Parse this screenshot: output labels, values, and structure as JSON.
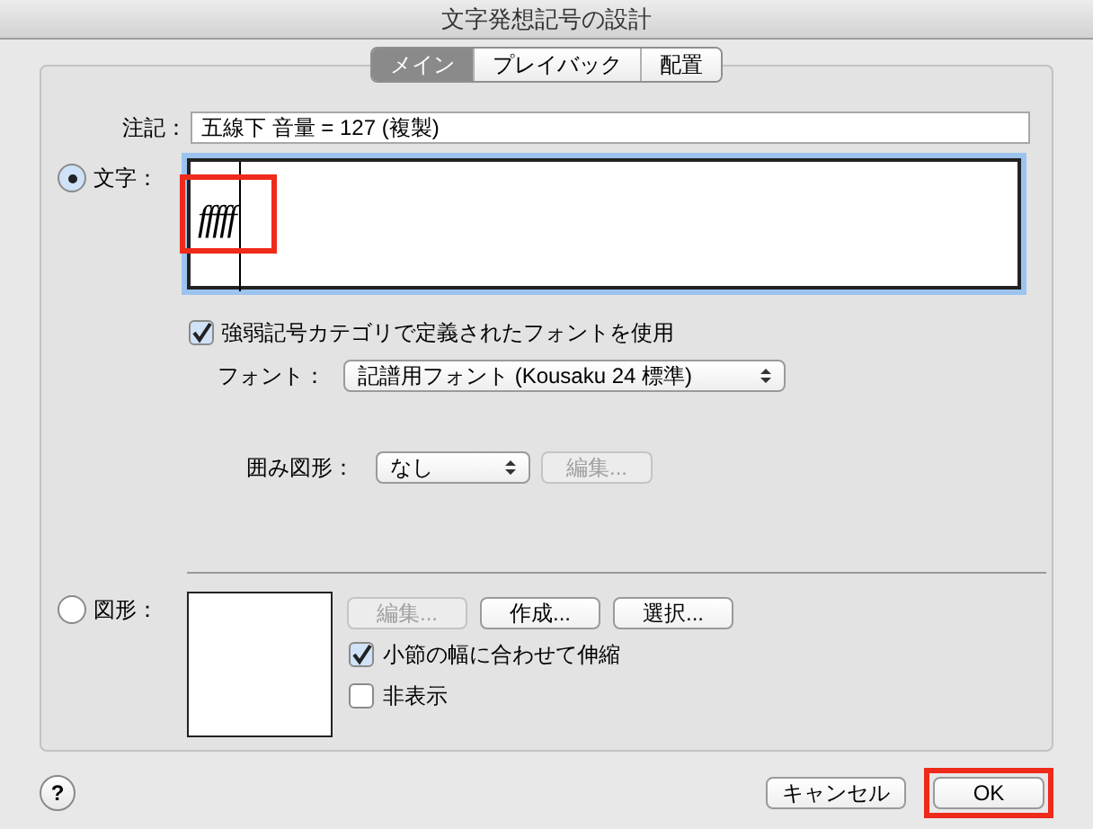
{
  "window": {
    "title": "文字発想記号の設計"
  },
  "tabs": [
    {
      "label": "メイン",
      "selected": true
    },
    {
      "label": "プレイバック",
      "selected": false
    },
    {
      "label": "配置",
      "selected": false
    }
  ],
  "annotation": {
    "label": "注記：",
    "value": "五線下 音量 = 127 (複製)"
  },
  "text_option": {
    "label": "文字：",
    "selected": true,
    "value": "fffff",
    "highlighted": true
  },
  "use_category_font": {
    "label": "強弱記号カテゴリで定義されたフォントを使用",
    "checked": true
  },
  "font": {
    "label": "フォント：",
    "value": "記譜用フォント (Kousaku 24 標準)"
  },
  "enclosure": {
    "label": "囲み図形：",
    "value": "なし",
    "edit_button": {
      "label": "編集...",
      "disabled": true
    }
  },
  "shape_option": {
    "label": "図形：",
    "selected": false
  },
  "shape_buttons": [
    {
      "label": "編集...",
      "disabled": true
    },
    {
      "label": "作成...",
      "disabled": false
    },
    {
      "label": "選択...",
      "disabled": false
    }
  ],
  "shape_checkboxes": [
    {
      "label": "小節の幅に合わせて伸縮",
      "checked": true
    },
    {
      "label": "非表示",
      "checked": false
    }
  ],
  "help": {
    "label": "?"
  },
  "buttons": [
    {
      "label": "キャンセル",
      "highlighted": false
    },
    {
      "label": "OK",
      "highlighted": true
    }
  ]
}
